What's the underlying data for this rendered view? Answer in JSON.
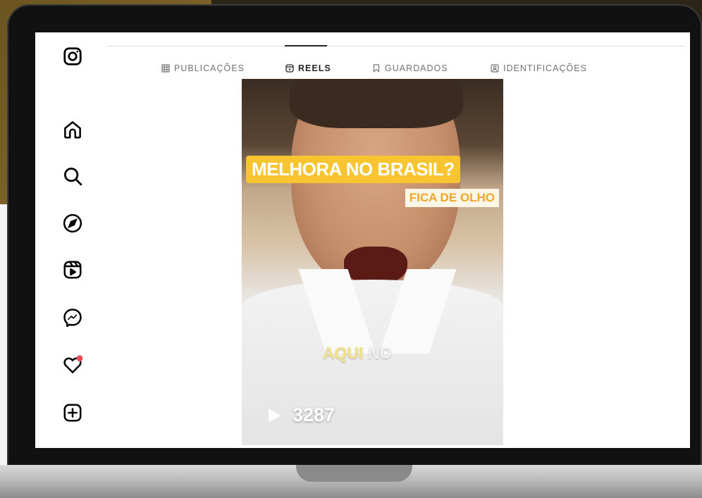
{
  "colors": {
    "accent_yellow": "#f8c530",
    "caption_orange": "#f1a623",
    "notification_red": "#ed4956",
    "tab_active": "#262626",
    "tab_inactive": "#737373"
  },
  "sidebar": {
    "items": [
      {
        "icon": "instagram-logo-icon"
      },
      {
        "icon": "home-icon"
      },
      {
        "icon": "search-icon"
      },
      {
        "icon": "explore-compass-icon"
      },
      {
        "icon": "reels-icon"
      },
      {
        "icon": "messenger-icon"
      },
      {
        "icon": "heart-notifications-icon"
      },
      {
        "icon": "create-plus-icon"
      }
    ]
  },
  "tabs": {
    "items": [
      {
        "label": "PUBLICAÇÕES",
        "icon": "grid-icon"
      },
      {
        "label": "REELS",
        "icon": "reels-icon",
        "active": true
      },
      {
        "label": "GUARDADOS",
        "icon": "bookmark-icon"
      },
      {
        "label": "IDENTIFICAÇÕES",
        "icon": "tagged-icon"
      }
    ]
  },
  "reel": {
    "caption_main": "MELHORA NO BRASIL?",
    "caption_sub": "FICA DE OLHO",
    "subtitle_highlight": "AQUI",
    "subtitle_rest": " NO",
    "views": "3287"
  }
}
